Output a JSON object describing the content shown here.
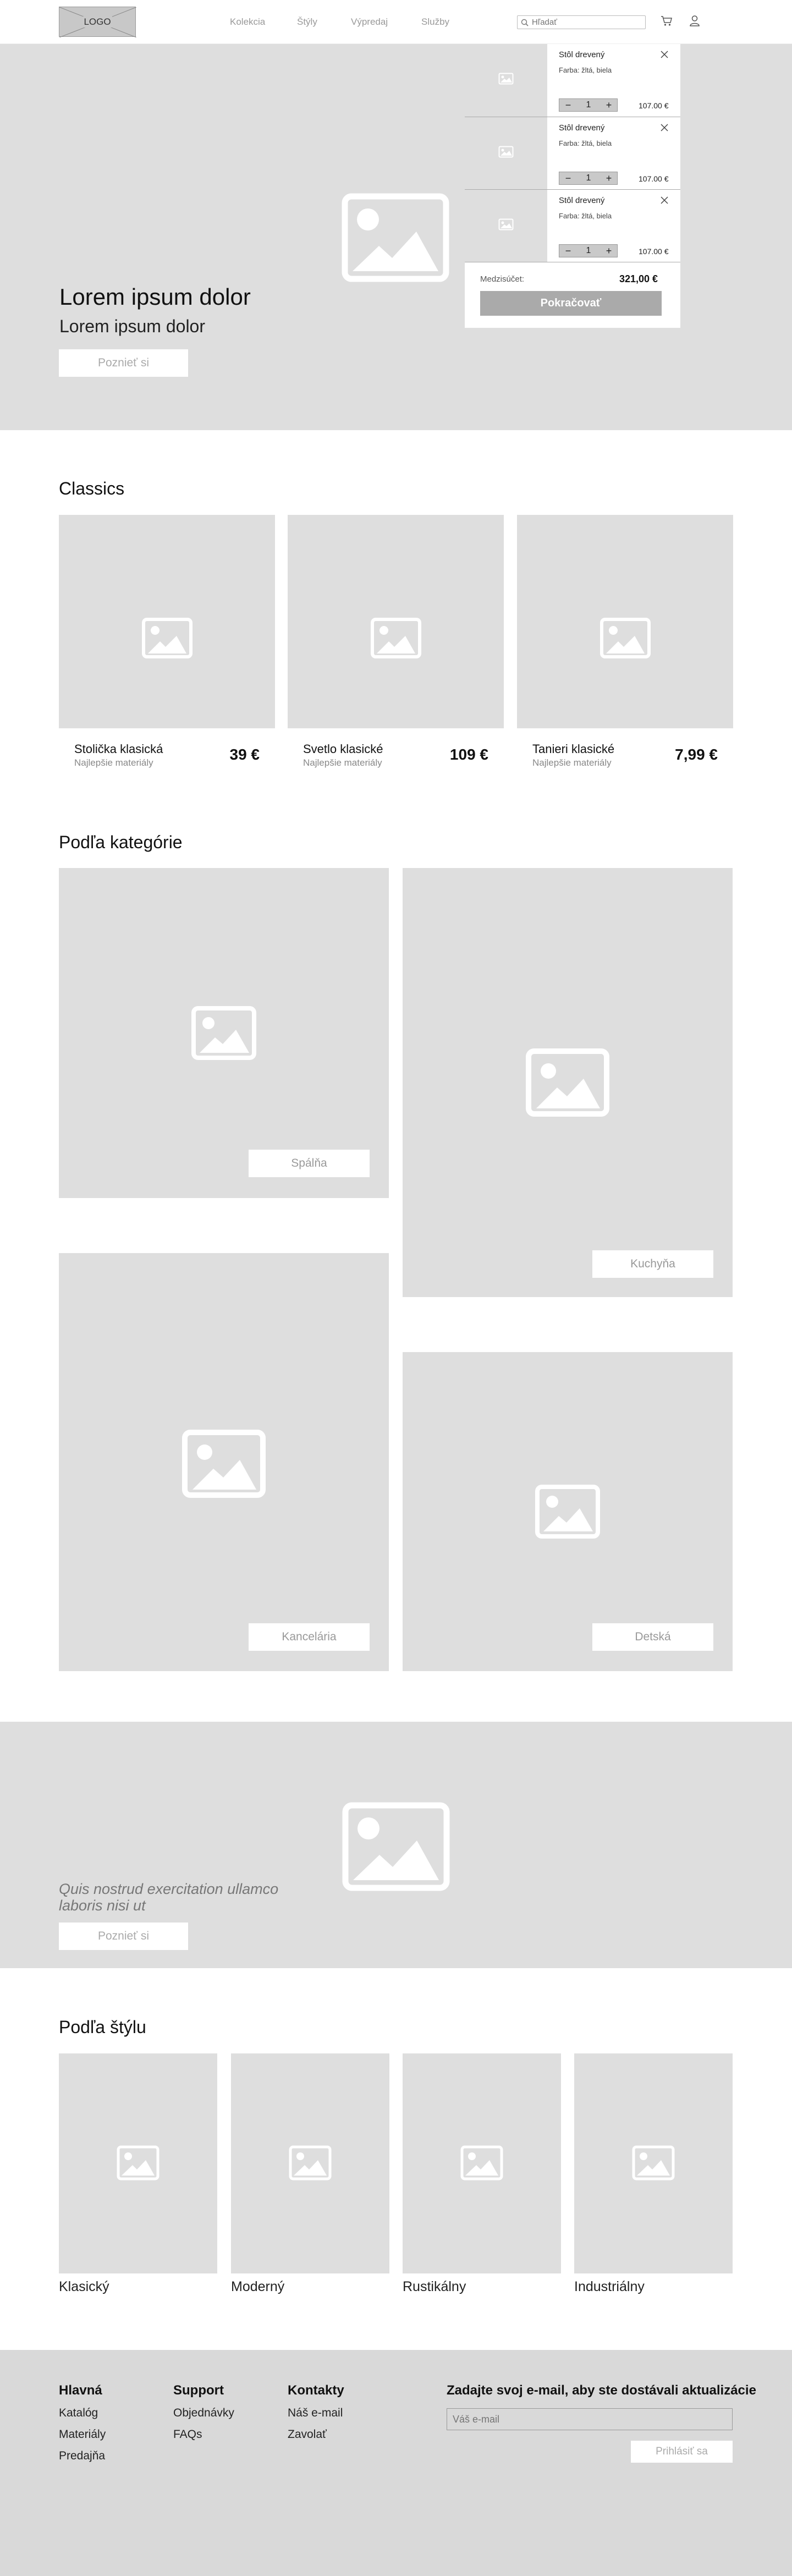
{
  "header": {
    "logo": "LOGO",
    "nav": [
      "Kolekcia",
      "Štýly",
      "Výpredaj",
      "Služby"
    ],
    "search_placeholder": "Hľadať"
  },
  "hero": {
    "title": "Lorem ipsum dolor",
    "subtitle": "Lorem ipsum dolor",
    "button": "Poznieť si"
  },
  "cart": {
    "items": [
      {
        "name": "Stôl drevený",
        "color": "Farba: žltá, biela",
        "quantity": "1",
        "price": "107.00 €"
      },
      {
        "name": "Stôl drevený",
        "color": "Farba: žltá, biela",
        "quantity": "1",
        "price": "107.00 €"
      },
      {
        "name": "Stôl drevený",
        "color": "Farba: žltá, biela",
        "quantity": "1",
        "price": "107.00 €"
      }
    ],
    "subtotal_label": "Medzisúčet:",
    "subtotal": "321,00 €",
    "continue_button": "Pokračovať",
    "minus": "−",
    "plus": "+"
  },
  "classics": {
    "title": "Classics",
    "items": [
      {
        "name": "Stolička klasická",
        "sub": "Najlepšie materiály",
        "price": "39 €"
      },
      {
        "name": "Svetlo klasické",
        "sub": "Najlepšie materiály",
        "price": "109 €"
      },
      {
        "name": "Tanieri klasické",
        "sub": "Najlepšie materiály",
        "price": "7,99 €"
      }
    ]
  },
  "categories": {
    "title": "Podľa kategórie",
    "items": [
      "Spálňa",
      "Kuchyňa",
      "Kancelária",
      "Detská"
    ]
  },
  "promo": {
    "text": "Quis nostrud exercitation ullamco laboris nisi ut",
    "button": "Poznieť si"
  },
  "styles": {
    "title": "Podľa štýlu",
    "items": [
      "Klasický",
      "Moderný",
      "Rustikálny",
      "Industriálny"
    ]
  },
  "footer": {
    "columns": [
      {
        "title": "Hlavná",
        "links": [
          "Katalóg",
          "Materiály",
          "Predajňa"
        ]
      },
      {
        "title": "Support",
        "links": [
          "Objednávky",
          "FAQs"
        ]
      },
      {
        "title": "Kontakty",
        "links": [
          "Náš e-mail",
          "Zavolať"
        ]
      }
    ],
    "newsletter_title": "Zadajte svoj e-mail, aby ste dostávali aktualizácie",
    "email_placeholder": "Váš e-mail",
    "subscribe_button": "Prihlásiť sa"
  },
  "colors": {
    "placeholder_gray": "#dedede",
    "footer_gray": "#d9d9d9",
    "button_gray": "#aaaaaa"
  }
}
